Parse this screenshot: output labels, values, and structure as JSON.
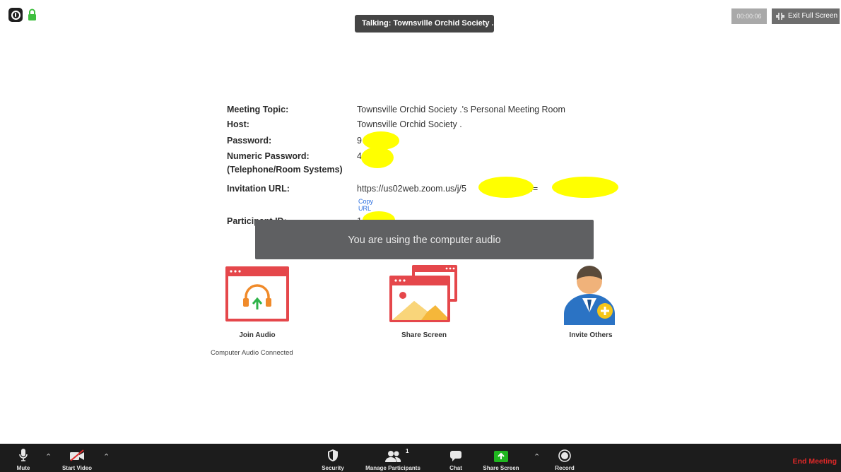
{
  "top_bar": {
    "talking_indicator": "Talking: Townsville Orchid Society .",
    "timer": "00:00:06",
    "exit_full_screen": "Exit Full Screen"
  },
  "meeting_info": {
    "topic_label": "Meeting Topic:",
    "topic_value": "Townsville Orchid Society .'s Personal Meeting Room",
    "host_label": "Host:",
    "host_value": "Townsville Orchid Society .",
    "password_label": "Password:",
    "password_value": "9",
    "numeric_password_label": "Numeric Password:",
    "numeric_password_sublabel": "(Telephone/Room Systems)",
    "numeric_password_value": "4",
    "invitation_url_label": "Invitation URL:",
    "invitation_url_value_start": "https://us02web.zoom.us/j/5",
    "invitation_url_value_mid": "?pwd=",
    "invitation_url_value_end": ".",
    "copy_url": "Copy URL",
    "participant_id_label": "Participant ID:",
    "participant_id_value": "1"
  },
  "toast": "You are using the computer audio",
  "actions": {
    "join_audio": "Join Audio",
    "join_audio_status": "Computer Audio Connected",
    "share_screen": "Share Screen",
    "invite_others": "Invite Others"
  },
  "toolbar": {
    "mute": "Mute",
    "start_video": "Start Video",
    "security": "Security",
    "manage_participants": "Manage Participants",
    "participant_count": "1",
    "chat": "Chat",
    "share_screen": "Share Screen",
    "record": "Record",
    "end_meeting": "End Meeting"
  },
  "colors": {
    "toolbar_bg": "#1c1c1c",
    "end_meeting": "#e02828",
    "share_green": "#1fb71f",
    "tile_red": "#e5474b",
    "redaction_yellow": "#ffff00"
  }
}
